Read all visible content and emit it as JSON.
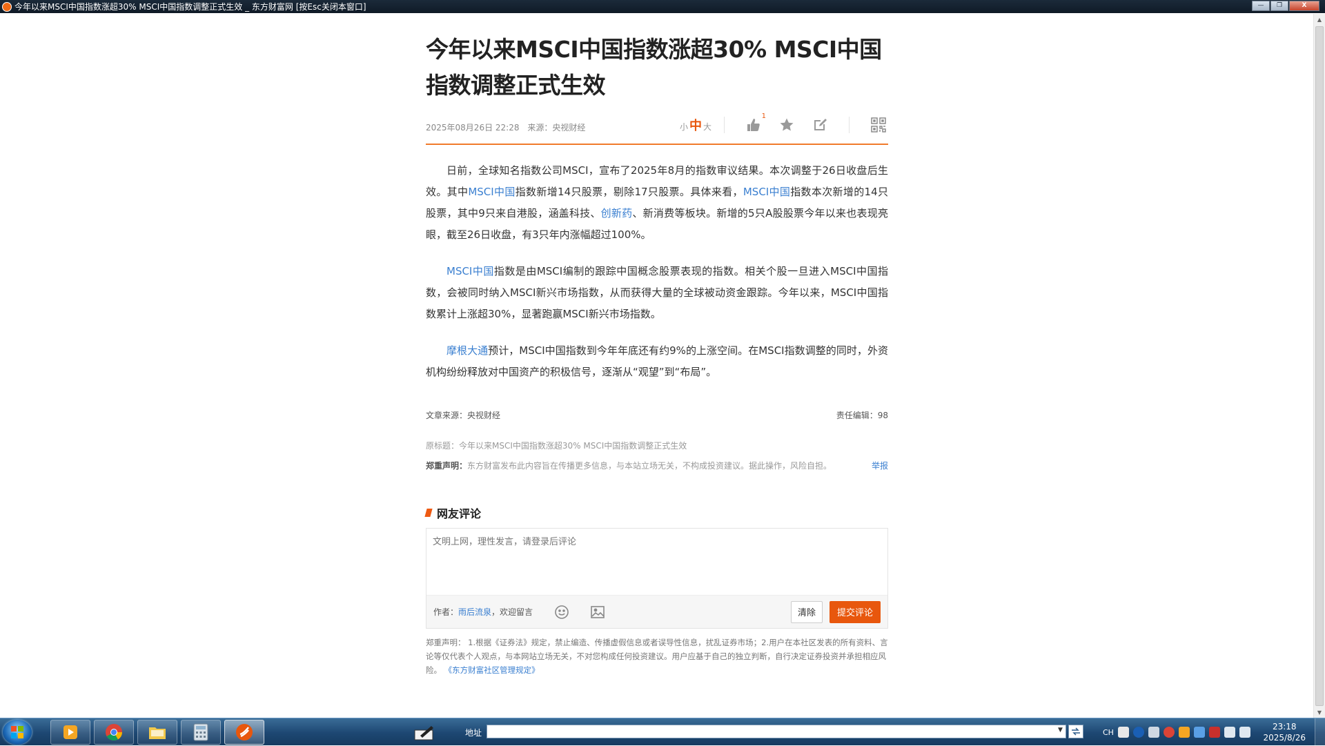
{
  "window": {
    "title": "今年以来MSCI中国指数涨超30% MSCI中国指数调整正式生效 _ 东方财富网  [按Esc关闭本窗口]",
    "minimize_label": "—",
    "maximize_label": "❐",
    "close_label": "X"
  },
  "article": {
    "headline": "今年以来MSCI中国指数涨超30% MSCI中国指数调整正式生效",
    "date": "2025年08月26日 22:28",
    "source": "来源：央视财经",
    "font_small": "小",
    "font_mid": "中",
    "font_large": "大",
    "like_count": "1",
    "paragraphs": [
      {
        "segments": [
          {
            "text": "日前，全球知名指数公司MSCI，宣布了2025年8月的指数审议结果。本次调整于26日收盘后生效。其中"
          },
          {
            "text": "MSCI中国",
            "link": true
          },
          {
            "text": "指数新增14只股票，剔除17只股票。具体来看，"
          },
          {
            "text": "MSCI中国",
            "link": true
          },
          {
            "text": "指数本次新增的14只股票，其中9只来自港股，涵盖科技、"
          },
          {
            "text": "创新药",
            "link": true
          },
          {
            "text": "、新消费等板块。新增的5只A股股票今年以来也表现亮眼，截至26日收盘，有3只年内涨幅超过100%。"
          }
        ]
      },
      {
        "segments": [
          {
            "text": "MSCI中国",
            "link": true
          },
          {
            "text": "指数是由MSCI编制的跟踪中国概念股票表现的指数。相关个股一旦进入MSCI中国指数，会被同时纳入MSCI新兴市场指数，从而获得大量的全球被动资金跟踪。今年以来，MSCI中国指数累计上涨超30%，显著跑赢MSCI新兴市场指数。"
          }
        ]
      },
      {
        "segments": [
          {
            "text": "摩根大通",
            "link": true
          },
          {
            "text": "预计，MSCI中国指数到今年年底还有约9%的上涨空间。在MSCI指数调整的同时，外资机构纷纷释放对中国资产的积极信号，逐渐从“观望”到“布局”。"
          }
        ]
      }
    ],
    "article_source": "文章来源：央视财经",
    "editor": "责任编辑：98",
    "original_title": "原标题：今年以来MSCI中国指数涨超30% MSCI中国指数调整正式生效",
    "disclaimer_label": "郑重声明：",
    "disclaimer_text": "东方财富发布此内容旨在传播更多信息，与本站立场无关，不构成投资建议。据此操作，风险自担。",
    "report_label": "举报"
  },
  "comments": {
    "heading": "网友评论",
    "placeholder": "文明上网，理性发言，请登录后评论",
    "author_label": "作者：",
    "author_name": "雨后流泉",
    "author_suffix": "，欢迎留言",
    "clear_label": "清除",
    "submit_label": "提交评论",
    "bottom_disclaimer": "郑重声明： 1.根据《证券法》规定，禁止编造、传播虚假信息或者误导性信息，扰乱证券市场；2.用户在本社区发表的所有资料、言论等仅代表个人观点，与本网站立场无关，不对您构成任何投资建议。用户应基于自己的独立判断，自行决定证券投资并承担相应风险。",
    "rules_link": "《东方财富社区管理规定》"
  },
  "taskbar": {
    "address_label": "地址",
    "address_value": "",
    "tray_lang": "CH",
    "time": "23:18",
    "date": "2025/8/26"
  },
  "colors": {
    "accent": "#e8570d",
    "link": "#3a7fd0"
  }
}
